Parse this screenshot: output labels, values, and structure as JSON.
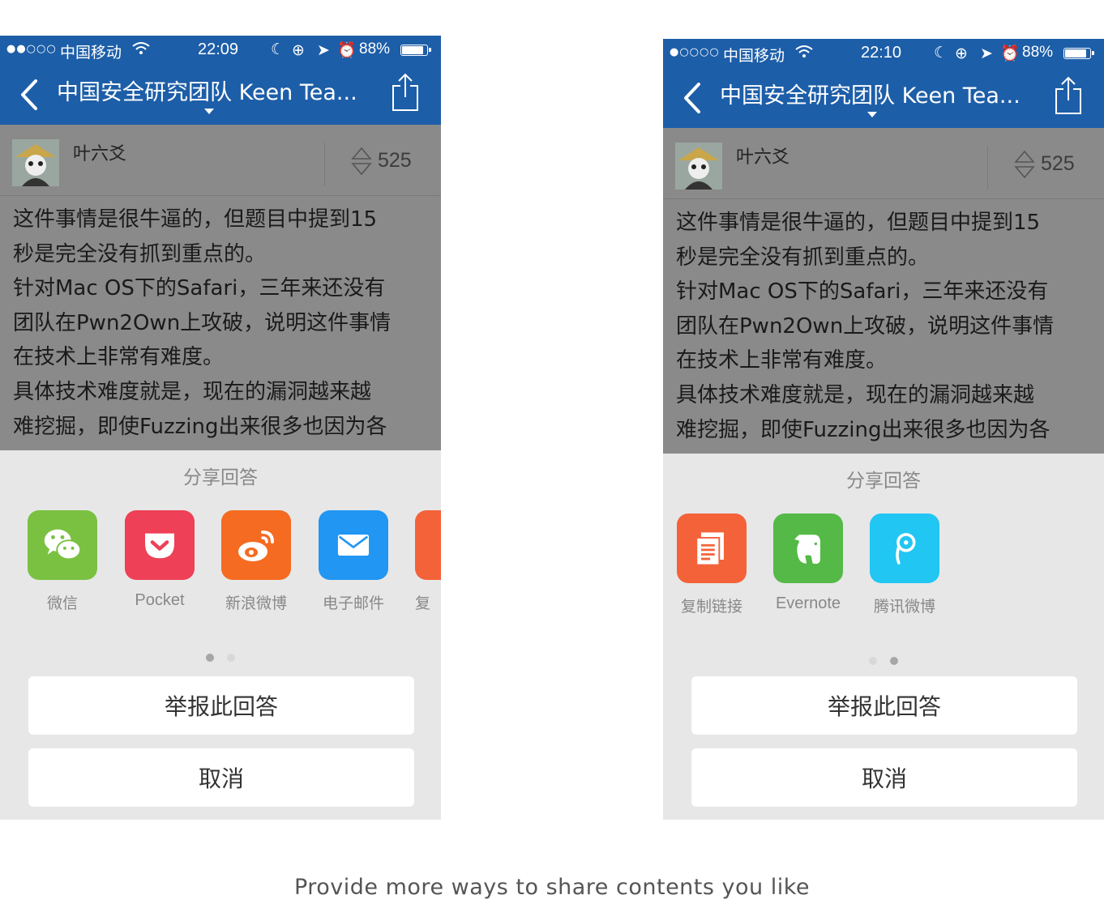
{
  "left_phone": {
    "status": {
      "carrier": "中国移动",
      "time": "22:09",
      "battery": "88%",
      "battery_level": 0.88
    },
    "nav": {
      "title": "中国安全研究团队 Keen Tea..."
    },
    "author": {
      "name": "叶六爻",
      "votes": "525"
    },
    "answer_lines": [
      "这件事情是很牛逼的，但题目中提到15",
      "秒是完全没有抓到重点的。",
      "针对Mac OS下的Safari，三年来还没有",
      "团队在Pwn2Own上攻破，说明这件事情",
      "在技术上非常有难度。",
      "具体技术难度就是，现在的漏洞越来越",
      "难挖掘，即使Fuzzing出来很多也因为各"
    ],
    "sheet": {
      "title": "分享回答",
      "apps": [
        {
          "label": "微信",
          "icon": "wechat-icon",
          "color": "#7ac142"
        },
        {
          "label": "Pocket",
          "icon": "pocket-icon",
          "color": "#ee4056"
        },
        {
          "label": "新浪微博",
          "icon": "weibo-icon",
          "color": "#f56b21"
        },
        {
          "label": "电子邮件",
          "icon": "mail-icon",
          "color": "#2196f3"
        },
        {
          "label": "复",
          "icon": "copy-link-icon",
          "color": "#f4623a"
        }
      ],
      "page": 1,
      "pages": 2,
      "report": "举报此回答",
      "cancel": "取消"
    }
  },
  "right_phone": {
    "status": {
      "carrier": "中国移动",
      "time": "22:10",
      "battery": "88%",
      "battery_level": 0.88
    },
    "nav": {
      "title": "中国安全研究团队 Keen Tea..."
    },
    "author": {
      "name": "叶六爻",
      "votes": "525"
    },
    "answer_lines": [
      "这件事情是很牛逼的，但题目中提到15",
      "秒是完全没有抓到重点的。",
      "针对Mac OS下的Safari，三年来还没有",
      "团队在Pwn2Own上攻破，说明这件事情",
      "在技术上非常有难度。",
      "具体技术难度就是，现在的漏洞越来越",
      "难挖掘，即使Fuzzing出来很多也因为各"
    ],
    "sheet": {
      "title": "分享回答",
      "apps": [
        {
          "label": "复制链接",
          "icon": "copy-link-icon",
          "color": "#f4623a"
        },
        {
          "label": "Evernote",
          "icon": "evernote-icon",
          "color": "#55b948"
        },
        {
          "label": "腾讯微博",
          "icon": "tencent-weibo-icon",
          "color": "#21c6f3"
        }
      ],
      "page": 2,
      "pages": 2,
      "report": "举报此回答",
      "cancel": "取消"
    }
  },
  "caption": "Provide more ways to share contents you like"
}
